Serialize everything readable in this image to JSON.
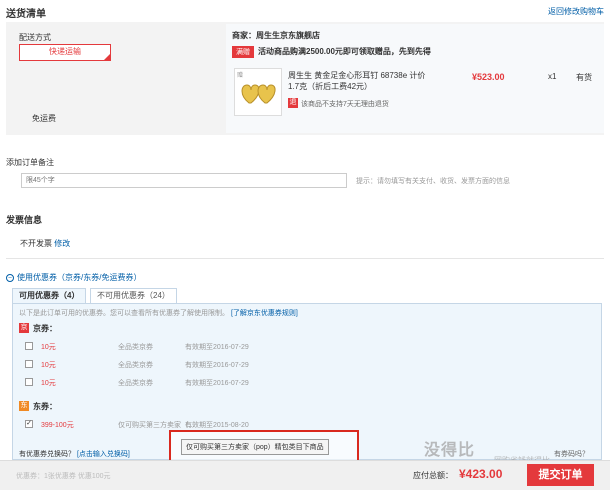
{
  "header": {
    "title": "送货清单",
    "back_link": "返回修改购物车"
  },
  "shipping": {
    "method_label": "配送方式",
    "method_button": "快递运输",
    "free_shipping": "免运费",
    "merchant": "商家：周生生京东旗舰店",
    "promo_badge": "满赠",
    "promo_text": "活动商品购满2500.00元即可领取赠品，先到先得",
    "product_tag": "赠",
    "product_name": "周生生 黄金足金心形耳钉 68738e 计价 1.7克（折后工费42元）",
    "price": "¥523.00",
    "qty": "x1",
    "stock": "有货",
    "no_return_icon": "退",
    "no_return": "该商品不支持7天无理由退货"
  },
  "remark": {
    "label": "添加订单备注",
    "placeholder": "限45个字",
    "tip": "提示：请勿填写有关支付、收货、发票方面的信息"
  },
  "invoice": {
    "title": "发票信息",
    "value": "不开发票",
    "edit": "修改"
  },
  "coupons": {
    "toggle": "使用优惠券（京券/东券/免运费券）",
    "tab_usable": "可用优惠券（4）",
    "tab_unusable": "不可用优惠券（24）",
    "tip": "以下是此订单可用的优惠券。您可以查看所有优惠券了解使用限制。",
    "tip_link": "[了解京东优惠券规则]",
    "jing_icon": "京",
    "jing_label": "京券：",
    "dong_icon": "东",
    "dong_label": "东券：",
    "jing_items": [
      {
        "amount": "10元",
        "scope": "全品类京券",
        "expiry": "有效期至2016-07-29"
      },
      {
        "amount": "10元",
        "scope": "全品类京券",
        "expiry": "有效期至2016-07-29"
      },
      {
        "amount": "10元",
        "scope": "全品类京券",
        "expiry": "有效期至2016-07-29"
      }
    ],
    "dong_items": [
      {
        "amount": "399-100元",
        "scope": "仅可购买第三方卖家（…",
        "expiry": "有效期至2015-08-20",
        "checked": true
      }
    ],
    "redeem_text": "有优惠券兑换码？",
    "redeem_link": "[点击输入兑换码]",
    "hover_tip": "仅可购买第三方卖家（pop）精包类目下商品",
    "right_text": "有券码吗？"
  },
  "footer": {
    "left_text": "优惠券：1张优惠券 优惠100元",
    "total_label": "应付总额：",
    "total_value": "¥423.00",
    "submit": "提交订单"
  },
  "watermark": {
    "main": "没得比",
    "sub": "网购省钱就得比"
  }
}
